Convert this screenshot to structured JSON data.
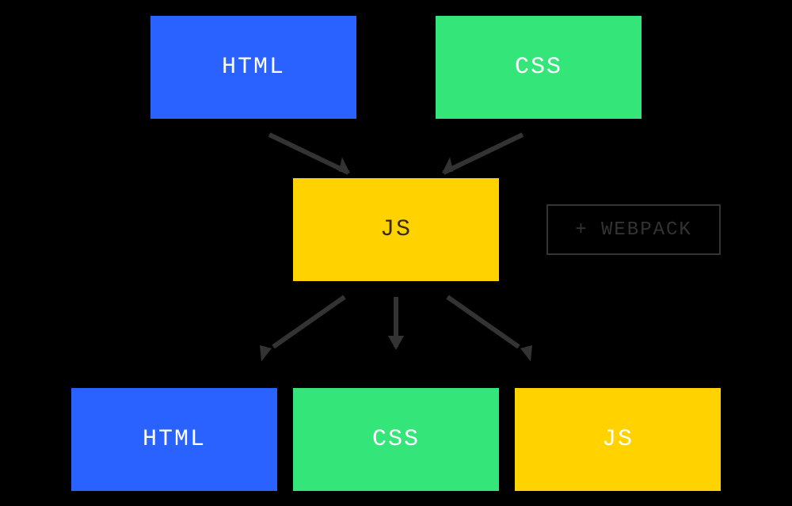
{
  "colors": {
    "blue": "#2962ff",
    "green": "#34e67a",
    "yellow": "#ffd200",
    "black": "#000000",
    "dark": "#333333"
  },
  "nodes": {
    "top_html": {
      "label": "HTML"
    },
    "top_css": {
      "label": "CSS"
    },
    "middle_js": {
      "label": "JS"
    },
    "webpack": {
      "label": "+ WEBPACK"
    },
    "bottom_html": {
      "label": "HTML"
    },
    "bottom_css": {
      "label": "CSS"
    },
    "bottom_js": {
      "label": "JS"
    }
  },
  "edges": [
    {
      "from": "top_html",
      "to": "middle_js"
    },
    {
      "from": "top_css",
      "to": "middle_js"
    },
    {
      "from": "middle_js",
      "to": "bottom_html"
    },
    {
      "from": "middle_js",
      "to": "bottom_css"
    },
    {
      "from": "middle_js",
      "to": "bottom_js"
    }
  ]
}
